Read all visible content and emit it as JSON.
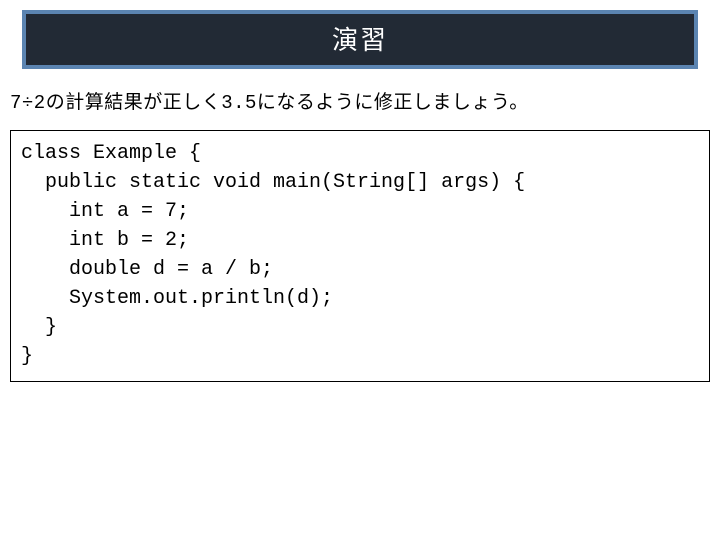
{
  "title": "演習",
  "instruction": "7÷2の計算結果が正しく3.5になるように修正しましょう。",
  "code": "class Example {\n  public static void main(String[] args) {\n    int a = 7;\n    int b = 2;\n    double d = a / b;\n    System.out.println(d);\n  }\n}"
}
